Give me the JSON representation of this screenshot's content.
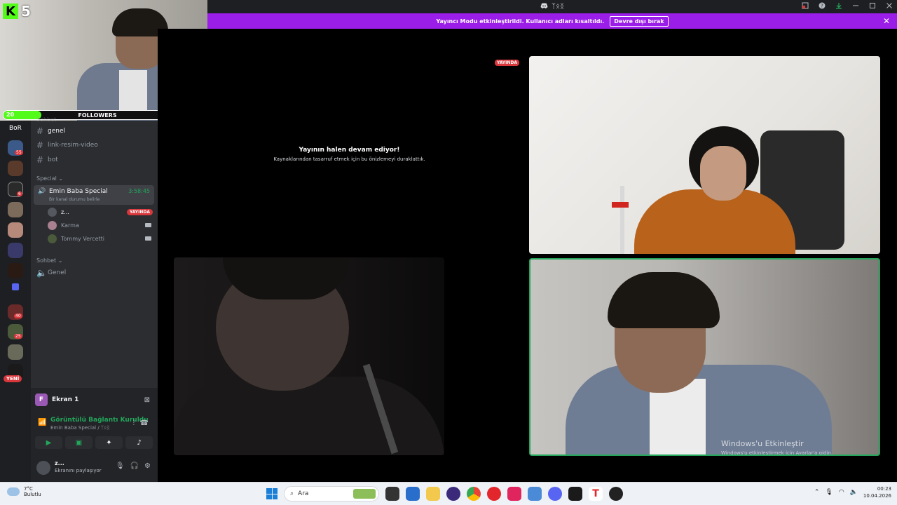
{
  "window": {
    "title": "ᛉᛟᛝ",
    "controls": [
      "open-in-popout",
      "help",
      "download",
      "minimize",
      "maximize",
      "close"
    ]
  },
  "banner": {
    "message": "Yayıncı Modu etkinleştirildi. Kullanıcı adları kısaltıldı.",
    "button": "Devre dışı bırak"
  },
  "overlay": {
    "channel_number": "5",
    "followers_label": "FOLLOWERS",
    "followers_current": 20,
    "followers_goal": 100,
    "followers_min_label": "20",
    "followers_max_label": "100"
  },
  "rail": {
    "top_label": "BoR",
    "badges": [
      "55",
      "6",
      "40",
      "25"
    ],
    "new_label": "YENİ"
  },
  "sidebar": {
    "faded_category": "Sohbet",
    "text_channels": [
      {
        "name": "genel",
        "active": true
      },
      {
        "name": "link-resim-video",
        "active": false
      },
      {
        "name": "bot",
        "active": false
      }
    ],
    "special_category": "Special",
    "voice_channel": {
      "name": "Emin Baba Special",
      "timer": "3:58:45",
      "status": "Bir kanal durumu belirle"
    },
    "members": [
      {
        "name": "z...",
        "live": "YAYINDA"
      },
      {
        "name": "Karma"
      },
      {
        "name": "Tommy Vercetti"
      }
    ],
    "chat_category": "Sohbet",
    "chat_voice_channel": "Genel"
  },
  "panel": {
    "screen_title": "Ekran 1",
    "screen_initial": "F",
    "connection_status": "Görüntülü Bağlantı Kuruldu",
    "connection_channel": "Emin Baba Special / ᛉᛟᛝ",
    "user_name": "z...",
    "user_status": "Ekranını paylaşıyor"
  },
  "stage": {
    "live_badge": "YAYINDA",
    "stream_paused_title": "Yayının halen devam ediyor!",
    "stream_paused_subtitle": "Kaynaklarından tasarruf etmek için bu önizlemeyi duraklattık.",
    "watermark_title": "Windows'u Etkinleştir",
    "watermark_subtitle": "Windows'u etkinleştirmek için Ayarlar'a gidin."
  },
  "taskbar": {
    "temperature": "7°C",
    "weather": "Bulutlu",
    "search_placeholder": "Ara",
    "time": "00:23",
    "date": "10.04.2026"
  },
  "colors": {
    "accent_purple": "#9b1de8",
    "discord_green": "#23a55a",
    "live_red": "#da373c",
    "kick_green": "#53fc18"
  }
}
